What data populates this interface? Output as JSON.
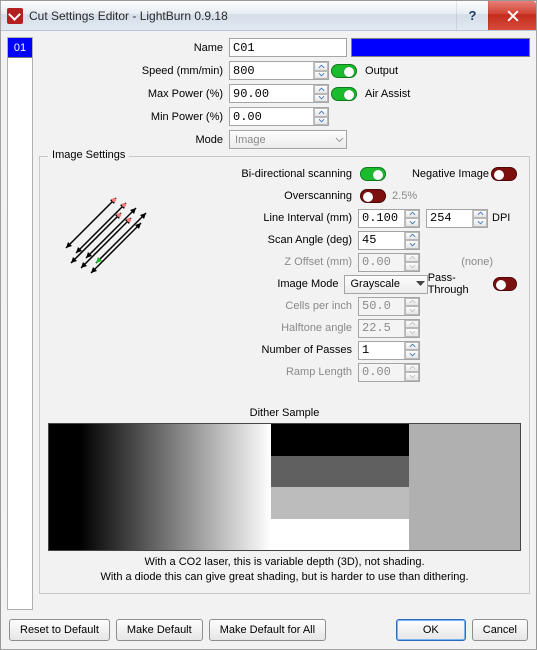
{
  "window": {
    "title": "Cut Settings Editor - LightBurn 0.9.18"
  },
  "sidebar": {
    "items": [
      {
        "id": "01",
        "color": "#0000ff"
      }
    ]
  },
  "fields": {
    "name": {
      "label": "Name",
      "value": "C01"
    },
    "speed": {
      "label": "Speed (mm/min)",
      "value": "800"
    },
    "maxpower": {
      "label": "Max Power (%)",
      "value": "90.00"
    },
    "minpower": {
      "label": "Min Power (%)",
      "value": "0.00"
    },
    "mode": {
      "label": "Mode",
      "value": "Image"
    },
    "output": {
      "label": "Output"
    },
    "airassist": {
      "label": "Air Assist"
    }
  },
  "imgset": {
    "legend": "Image Settings",
    "bidi": {
      "label": "Bi-directional scanning"
    },
    "neg": {
      "label": "Negative Image"
    },
    "overscan": {
      "label": "Overscanning",
      "value": "2.5%"
    },
    "lineint": {
      "label": "Line Interval (mm)",
      "value": "0.100",
      "dpi_val": "254",
      "dpi_unit": "DPI"
    },
    "scanangle": {
      "label": "Scan Angle (deg)",
      "value": "45"
    },
    "zoffset": {
      "label": "Z Offset (mm)",
      "value": "0.00",
      "right": "(none)"
    },
    "imagemode": {
      "label": "Image Mode",
      "value": "Grayscale"
    },
    "passthrough": {
      "label": "Pass-Through"
    },
    "cells": {
      "label": "Cells per inch",
      "value": "50.0"
    },
    "halftone": {
      "label": "Halftone angle",
      "value": "22.5"
    },
    "passes": {
      "label": "Number of Passes",
      "value": "1"
    },
    "ramp": {
      "label": "Ramp Length",
      "value": "0.00"
    },
    "dither_title": "Dither Sample",
    "note1": "With a CO2 laser, this is variable depth (3D), not shading.",
    "note2": "With a diode this can give great shading, but is harder to use than dithering."
  },
  "buttons": {
    "reset": "Reset to Default",
    "makedef": "Make Default",
    "makedefall": "Make Default for All",
    "ok": "OK",
    "cancel": "Cancel"
  },
  "bands": [
    "#000000",
    "#606060",
    "#bcbcbc",
    "#ffffff"
  ]
}
